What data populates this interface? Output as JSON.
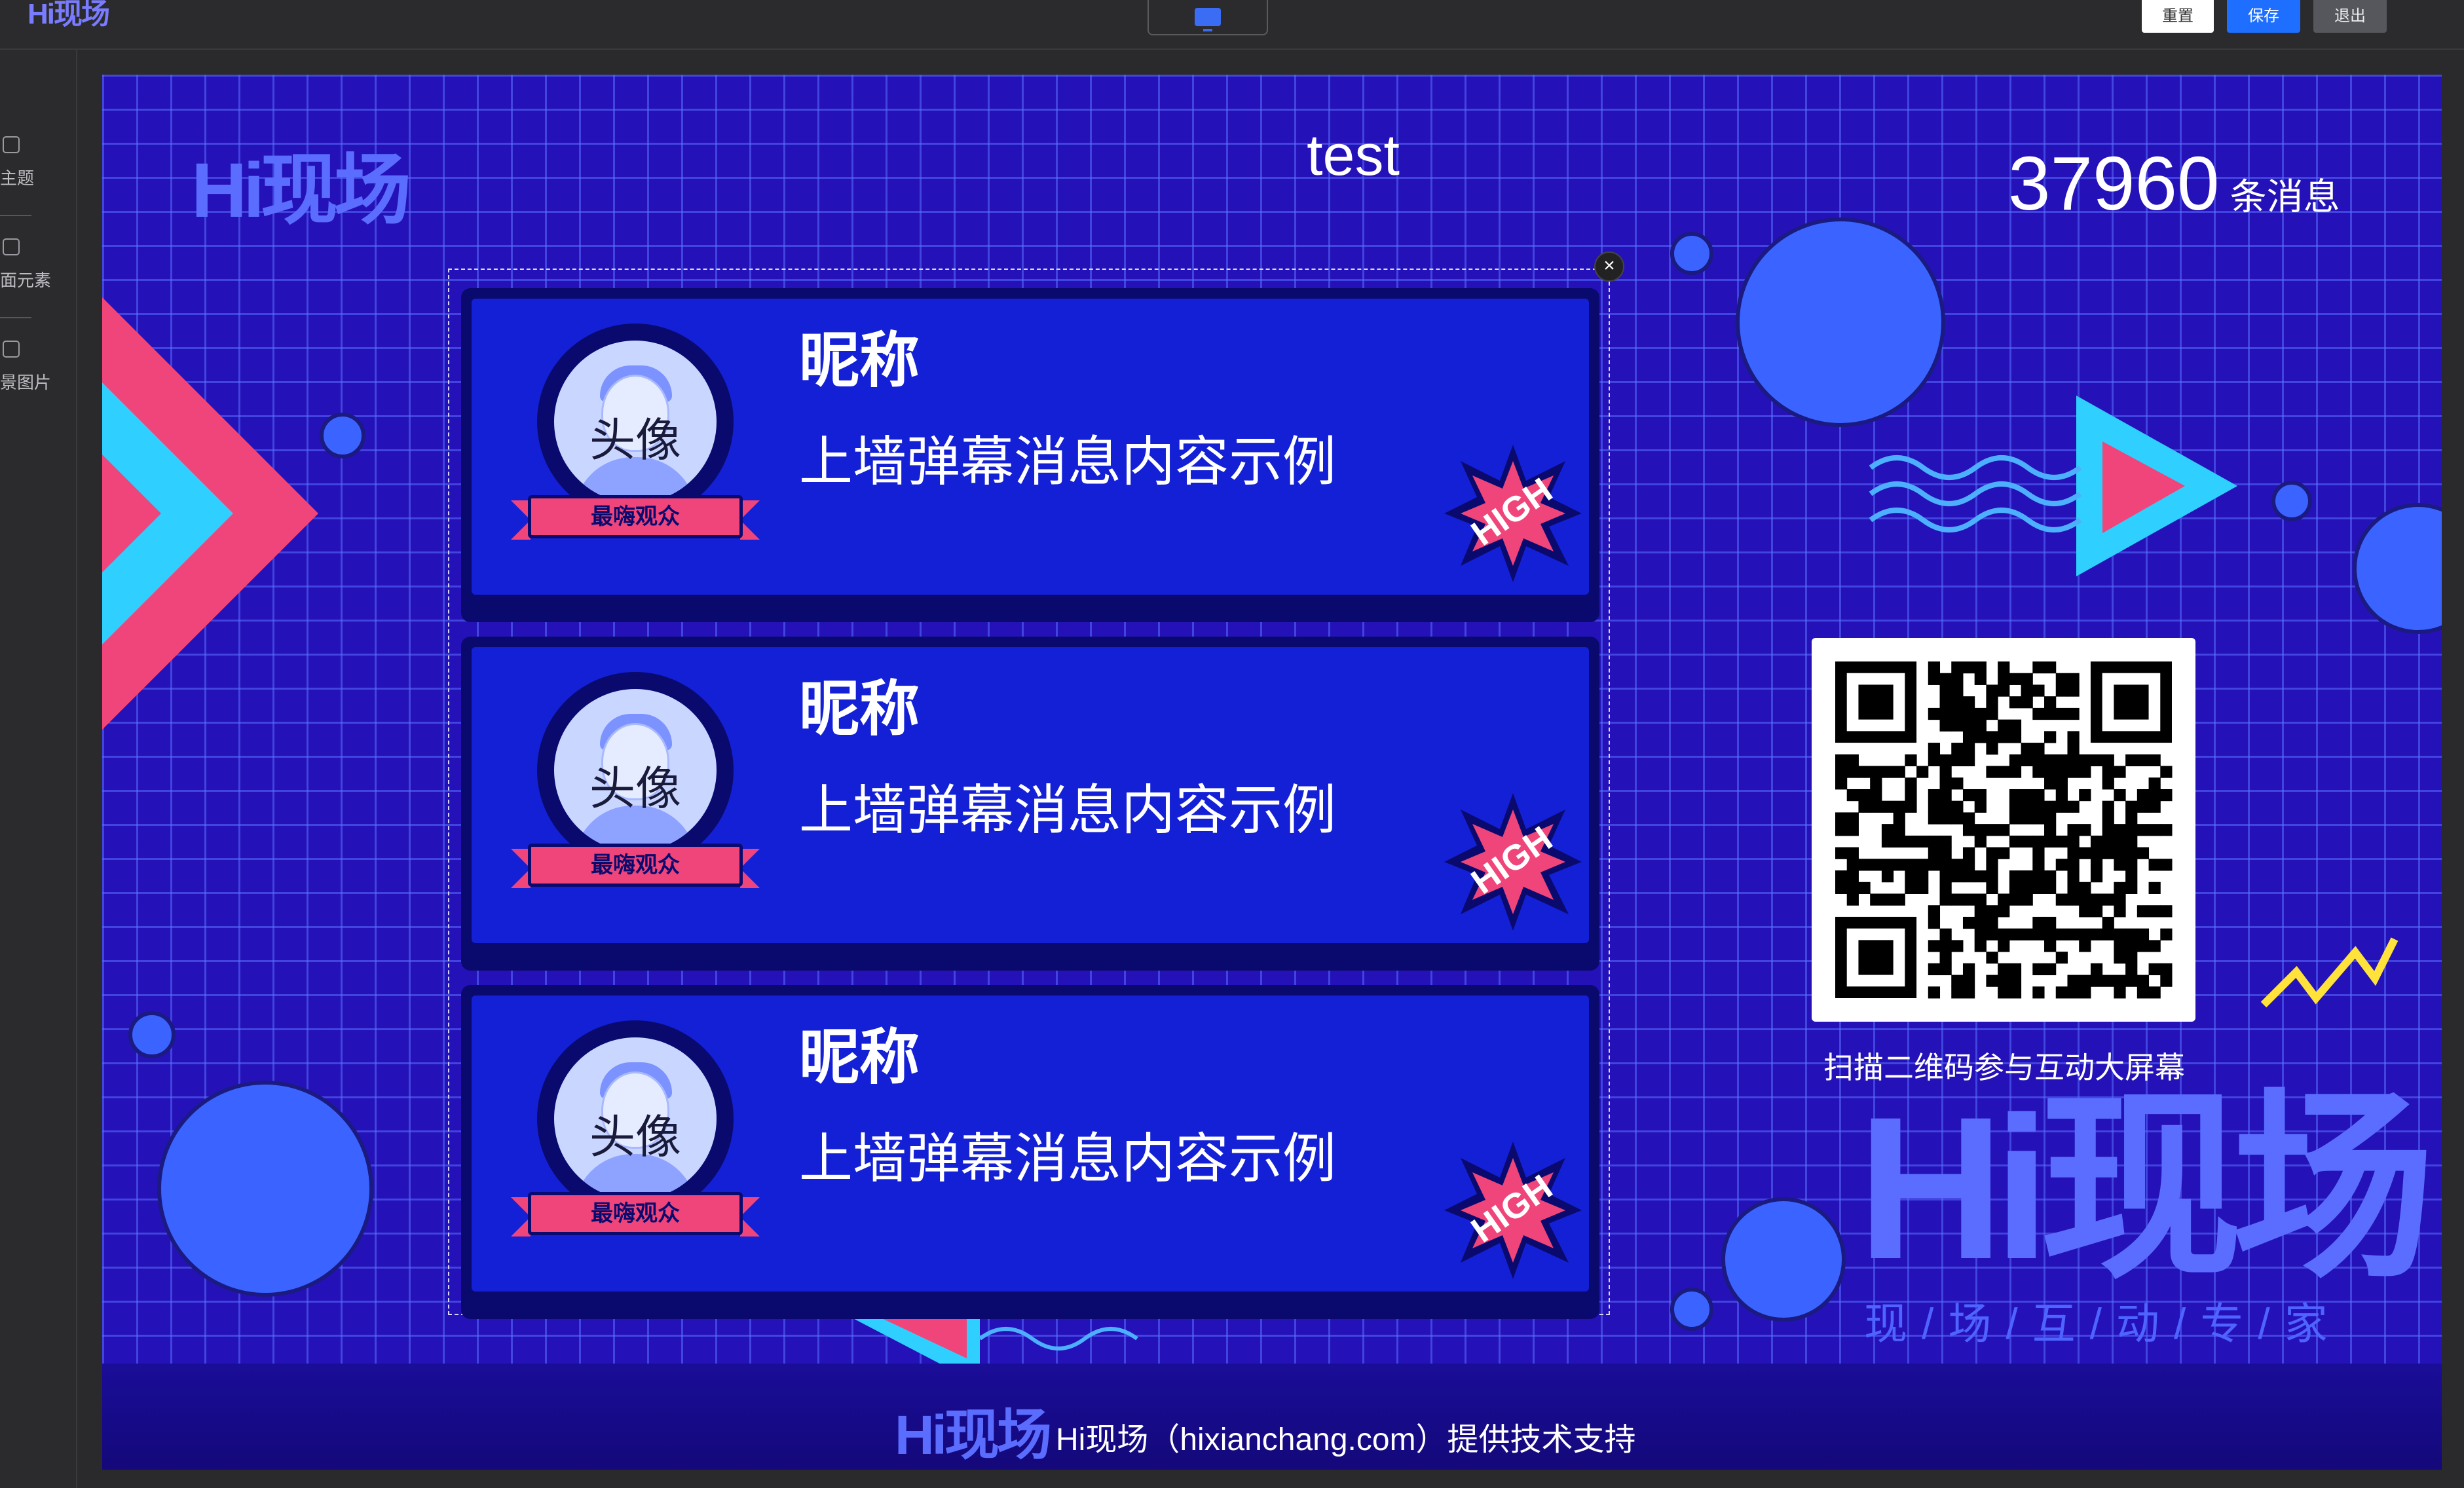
{
  "topbar": {
    "brand": "Hi现场",
    "buttons": {
      "reset": "重置",
      "save": "保存",
      "exit": "退出"
    }
  },
  "sidebar": {
    "items": [
      {
        "label": "主题",
        "icon": "theme-icon"
      },
      {
        "label": "面元素",
        "icon": "elements-icon"
      },
      {
        "label": "景图片",
        "icon": "image-icon"
      }
    ]
  },
  "stage": {
    "title": "test",
    "logo": "Hi现场",
    "message_count": "37960",
    "message_count_unit": "条消息",
    "messages": [
      {
        "avatar_text": "头像",
        "badge": "最嗨观众",
        "nickname": "昵称",
        "content": "上墙弹幕消息内容示例",
        "sticker": "HIGH"
      },
      {
        "avatar_text": "头像",
        "badge": "最嗨观众",
        "nickname": "昵称",
        "content": "上墙弹幕消息内容示例",
        "sticker": "HIGH"
      },
      {
        "avatar_text": "头像",
        "badge": "最嗨观众",
        "nickname": "昵称",
        "content": "上墙弹幕消息内容示例",
        "sticker": "HIGH"
      }
    ],
    "qr_caption": "扫描二维码参与互动大屏幕",
    "big_logo": "Hi现场",
    "slogan": "现/场/互/动/专/家",
    "footer_logo": "Hi现场",
    "footer_text": "Hi现场（hixianchang.com）提供技术支持"
  },
  "colors": {
    "accent_blue": "#1e6fff",
    "stage_bg": "#2412b8",
    "card_bg": "#1320d6",
    "pink": "#f0457a",
    "cyan": "#2fd0ff",
    "logo_orange": "#ff8a3d"
  }
}
